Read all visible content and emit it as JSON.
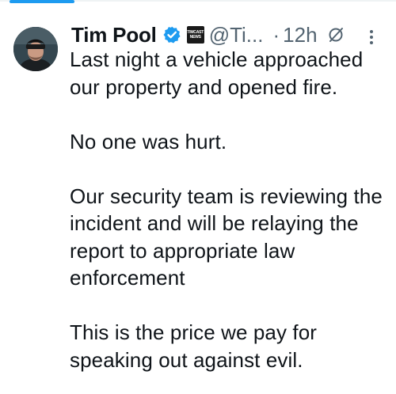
{
  "tweet": {
    "author": {
      "display_name": "Tim Pool",
      "handle": "@Ti...",
      "verified_icon": "verified-badge-icon",
      "affiliate_badge_lines": [
        "TIMCAST",
        "NEWS"
      ]
    },
    "separator": "·",
    "timestamp": "12h",
    "paragraphs": [
      "Last night a vehicle approached our property and opened fire.",
      "No one was hurt.",
      "Our security team is reviewing the incident and will be relaying the report to appropriate law enforcement",
      "This is the price we pay for speaking out against evil."
    ]
  },
  "colors": {
    "accent": "#1d9bf0",
    "text": "#0f1419",
    "secondary_text": "#536471"
  }
}
